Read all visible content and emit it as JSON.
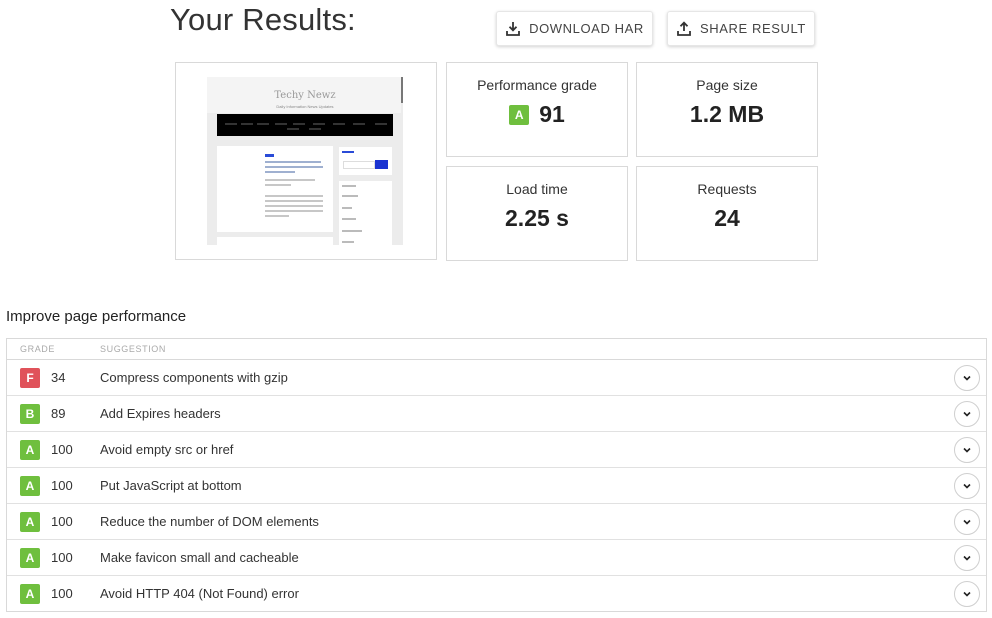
{
  "header": {
    "title": "Your Results:",
    "download_label": "DOWNLOAD HAR",
    "share_label": "SHARE RESULT"
  },
  "preview": {
    "site_title": "Techy Newz",
    "site_tagline": "Daily Information News Updates"
  },
  "metrics": {
    "performance": {
      "label": "Performance grade",
      "grade": "A",
      "value": "91",
      "color": "#6fbf3e"
    },
    "page_size": {
      "label": "Page size",
      "value": "1.2 MB"
    },
    "load_time": {
      "label": "Load time",
      "value": "2.25 s"
    },
    "requests": {
      "label": "Requests",
      "value": "24"
    }
  },
  "improve": {
    "title": "Improve page performance",
    "columns": {
      "grade": "GRADE",
      "suggestion": "SUGGESTION"
    },
    "rows": [
      {
        "grade": "F",
        "score": "34",
        "suggestion": "Compress components with gzip",
        "color": "#e0525a"
      },
      {
        "grade": "B",
        "score": "89",
        "suggestion": "Add Expires headers",
        "color": "#6fbf3e"
      },
      {
        "grade": "A",
        "score": "100",
        "suggestion": "Avoid empty src or href",
        "color": "#6fbf3e"
      },
      {
        "grade": "A",
        "score": "100",
        "suggestion": "Put JavaScript at bottom",
        "color": "#6fbf3e"
      },
      {
        "grade": "A",
        "score": "100",
        "suggestion": "Reduce the number of DOM elements",
        "color": "#6fbf3e"
      },
      {
        "grade": "A",
        "score": "100",
        "suggestion": "Make favicon small and cacheable",
        "color": "#6fbf3e"
      },
      {
        "grade": "A",
        "score": "100",
        "suggestion": "Avoid HTTP 404 (Not Found) error",
        "color": "#6fbf3e"
      }
    ]
  },
  "icons": {
    "download": "download-icon",
    "share": "share-icon",
    "expand": "chevron-down-icon"
  }
}
